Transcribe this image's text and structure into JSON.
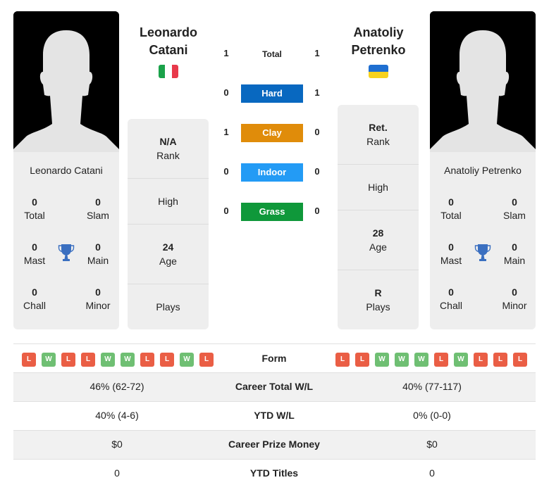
{
  "player1": {
    "name_line1": "Leonardo",
    "name_line2": "Catani",
    "card_name": "Leonardo Catani",
    "country": "Italy",
    "flag_colors": [
      "#1aa24a",
      "#ffffff",
      "#e8394b"
    ],
    "titles": {
      "total": {
        "value": "0",
        "label": "Total"
      },
      "slam": {
        "value": "0",
        "label": "Slam"
      },
      "mast": {
        "value": "0",
        "label": "Mast"
      },
      "main": {
        "value": "0",
        "label": "Main"
      },
      "chall": {
        "value": "0",
        "label": "Chall"
      },
      "minor": {
        "value": "0",
        "label": "Minor"
      }
    },
    "info": [
      {
        "value": "N/A",
        "label": "Rank"
      },
      {
        "value": "",
        "label": "High"
      },
      {
        "value": "24",
        "label": "Age"
      },
      {
        "value": "",
        "label": "Plays"
      }
    ],
    "form": [
      "L",
      "W",
      "L",
      "L",
      "W",
      "W",
      "L",
      "L",
      "W",
      "L"
    ]
  },
  "player2": {
    "name_line1": "Anatoliy",
    "name_line2": "Petrenko",
    "card_name": "Anatoliy Petrenko",
    "country": "Ukraine",
    "flag_colors": [
      "#1f6fd1",
      "#f7d21e"
    ],
    "titles": {
      "total": {
        "value": "0",
        "label": "Total"
      },
      "slam": {
        "value": "0",
        "label": "Slam"
      },
      "mast": {
        "value": "0",
        "label": "Mast"
      },
      "main": {
        "value": "0",
        "label": "Main"
      },
      "chall": {
        "value": "0",
        "label": "Chall"
      },
      "minor": {
        "value": "0",
        "label": "Minor"
      }
    },
    "info": [
      {
        "value": "Ret.",
        "label": "Rank"
      },
      {
        "value": "",
        "label": "High"
      },
      {
        "value": "28",
        "label": "Age"
      },
      {
        "value": "R",
        "label": "Plays"
      }
    ],
    "form": [
      "L",
      "L",
      "W",
      "W",
      "W",
      "L",
      "W",
      "L",
      "L",
      "L"
    ]
  },
  "h2h": [
    {
      "label": "Total",
      "p1": "1",
      "p2": "1",
      "color": ""
    },
    {
      "label": "Hard",
      "p1": "0",
      "p2": "1",
      "color": "#0868c0"
    },
    {
      "label": "Clay",
      "p1": "1",
      "p2": "0",
      "color": "#e08c0a"
    },
    {
      "label": "Indoor",
      "p1": "0",
      "p2": "0",
      "color": "#239bf5"
    },
    {
      "label": "Grass",
      "p1": "0",
      "p2": "0",
      "color": "#0f983a"
    }
  ],
  "form_label": "Form",
  "stats": [
    {
      "label": "Career Total W/L",
      "p1": "46% (62-72)",
      "p2": "40% (77-117)"
    },
    {
      "label": "YTD W/L",
      "p1": "40% (4-6)",
      "p2": "0% (0-0)"
    },
    {
      "label": "Career Prize Money",
      "p1": "$0",
      "p2": "$0"
    },
    {
      "label": "YTD Titles",
      "p1": "0",
      "p2": "0"
    }
  ],
  "colors": {
    "loss": "#ea5e45",
    "win": "#6fbf73",
    "trophy": "#3a6fc0"
  }
}
